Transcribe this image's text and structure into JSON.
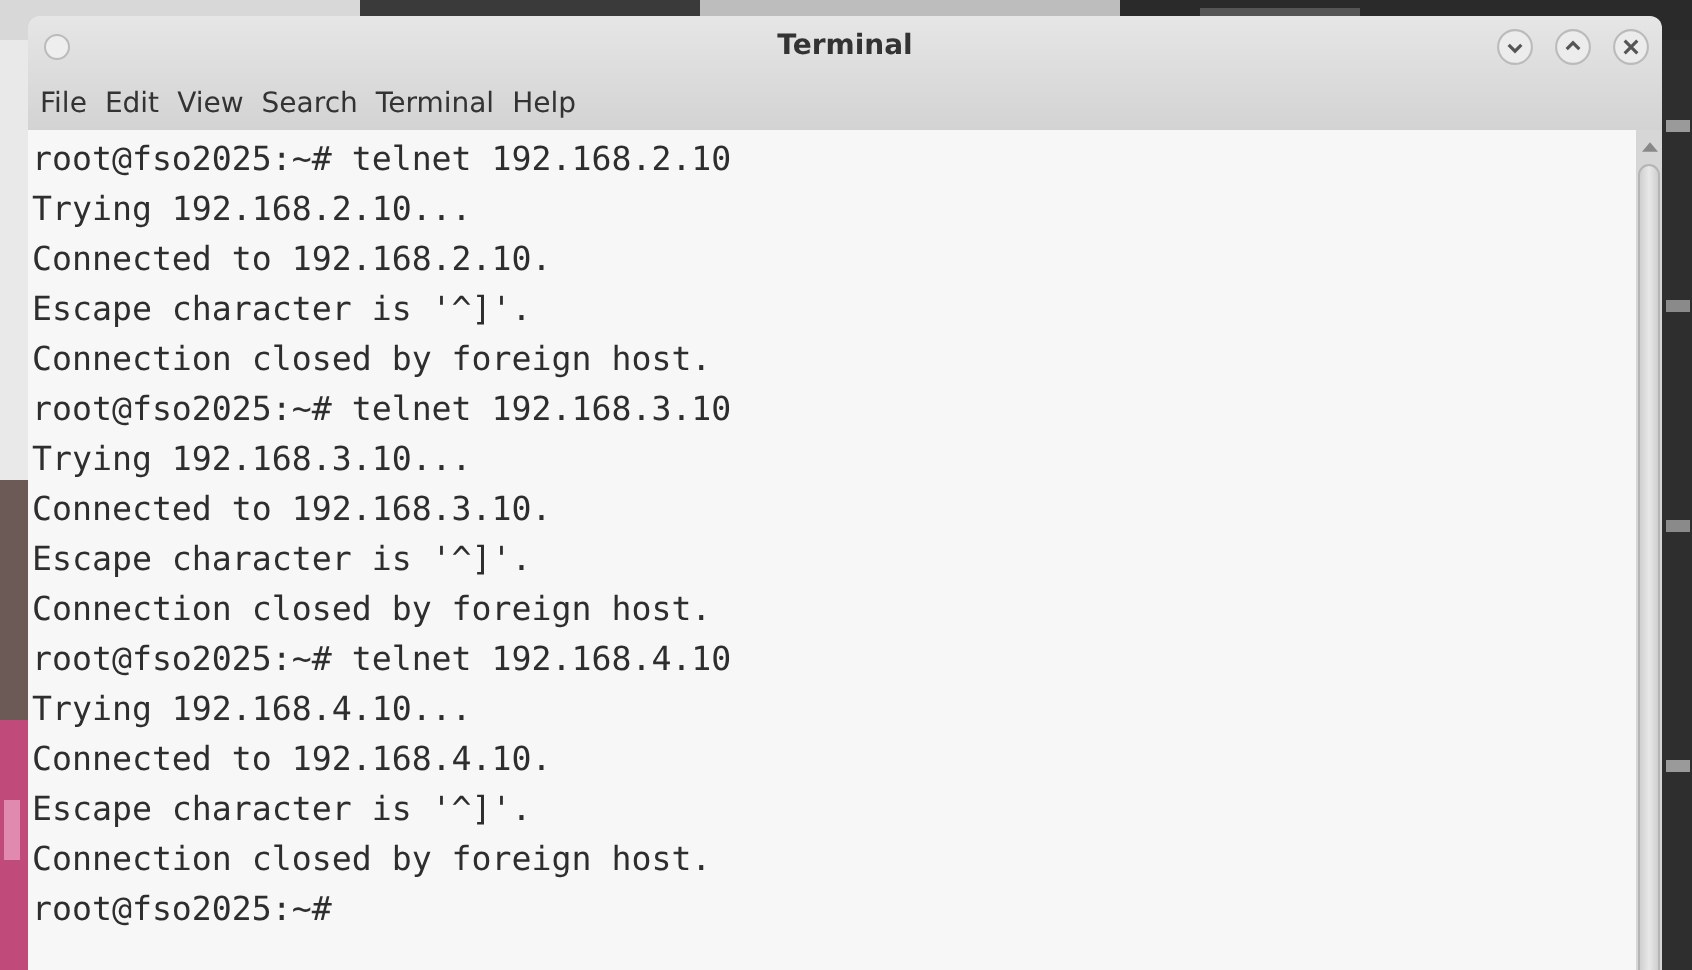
{
  "window": {
    "title": "Terminal"
  },
  "menu": [
    "File",
    "Edit",
    "View",
    "Search",
    "Terminal",
    "Help"
  ],
  "terminal_lines": [
    "root@fso2025:~# telnet 192.168.2.10",
    "Trying 192.168.2.10...",
    "Connected to 192.168.2.10.",
    "Escape character is '^]'.",
    "Connection closed by foreign host.",
    "root@fso2025:~# telnet 192.168.3.10",
    "Trying 192.168.3.10...",
    "Connected to 192.168.3.10.",
    "Escape character is '^]'.",
    "Connection closed by foreign host.",
    "root@fso2025:~# telnet 192.168.4.10",
    "Trying 192.168.4.10...",
    "Connected to 192.168.4.10.",
    "Escape character is '^]'.",
    "Connection closed by foreign host.",
    "root@fso2025:~#"
  ]
}
